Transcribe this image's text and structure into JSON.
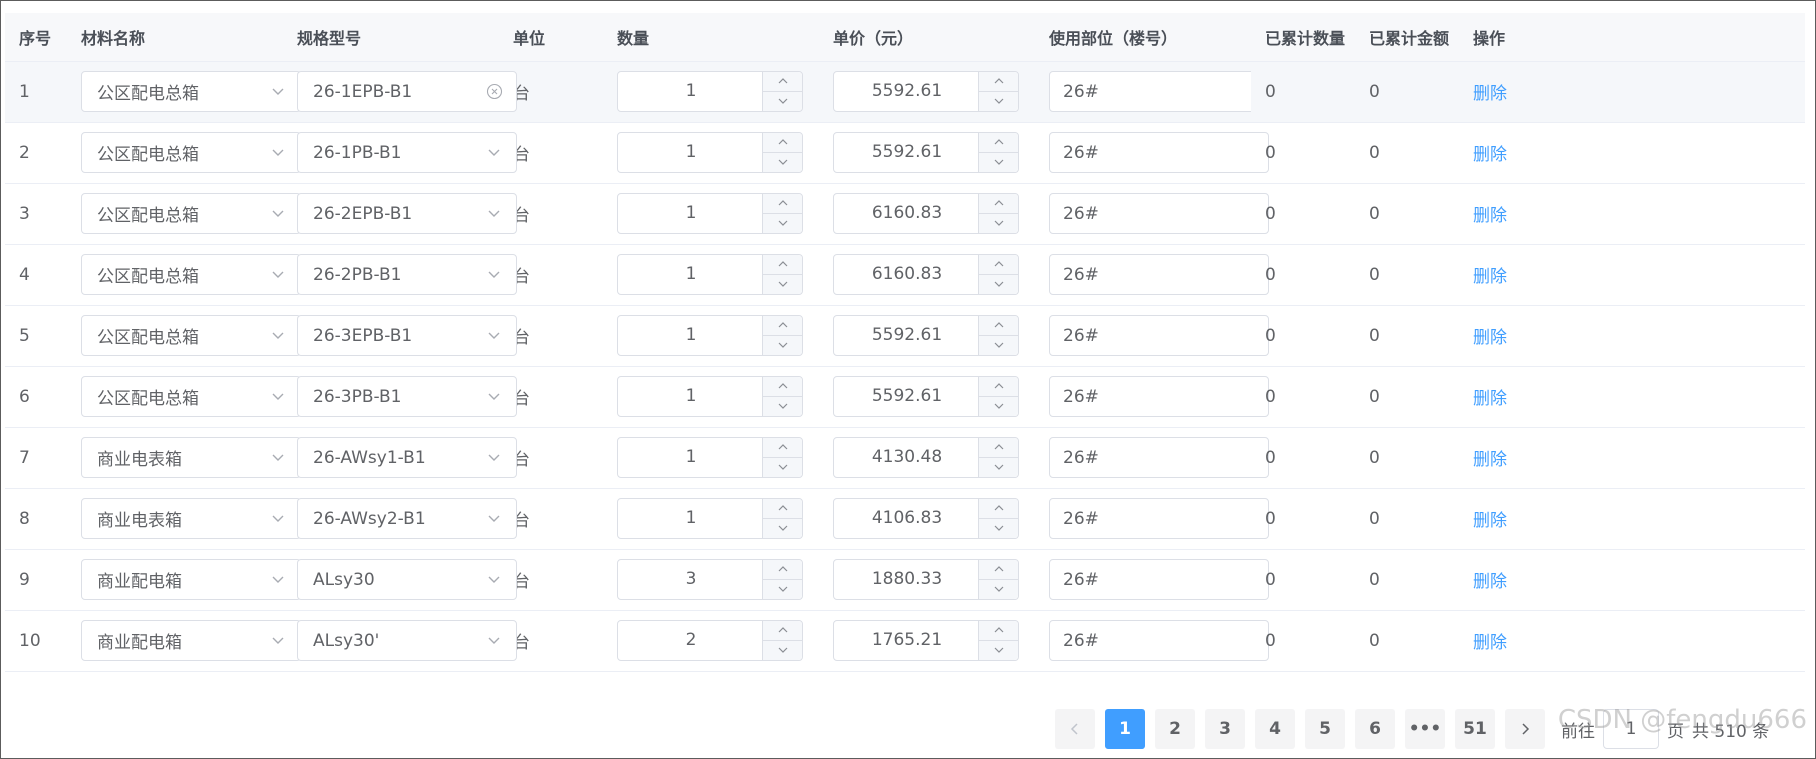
{
  "columns": [
    "序号",
    "材料名称",
    "规格型号",
    "单位",
    "数量",
    "单价（元）",
    "使用部位（楼号）",
    "已累计数量",
    "已累计金额",
    "操作"
  ],
  "rows": [
    {
      "index": "1",
      "material": "公区配电总箱",
      "spec": "26-1EPB-B1",
      "unit": "台",
      "qty": "1",
      "price": "5592.61",
      "location": "26#",
      "acc_qty": "0",
      "acc_amount": "0",
      "action": "删除"
    },
    {
      "index": "2",
      "material": "公区配电总箱",
      "spec": "26-1PB-B1",
      "unit": "台",
      "qty": "1",
      "price": "5592.61",
      "location": "26#",
      "acc_qty": "0",
      "acc_amount": "0",
      "action": "删除"
    },
    {
      "index": "3",
      "material": "公区配电总箱",
      "spec": "26-2EPB-B1",
      "unit": "台",
      "qty": "1",
      "price": "6160.83",
      "location": "26#",
      "acc_qty": "0",
      "acc_amount": "0",
      "action": "删除"
    },
    {
      "index": "4",
      "material": "公区配电总箱",
      "spec": "26-2PB-B1",
      "unit": "台",
      "qty": "1",
      "price": "6160.83",
      "location": "26#",
      "acc_qty": "0",
      "acc_amount": "0",
      "action": "删除"
    },
    {
      "index": "5",
      "material": "公区配电总箱",
      "spec": "26-3EPB-B1",
      "unit": "台",
      "qty": "1",
      "price": "5592.61",
      "location": "26#",
      "acc_qty": "0",
      "acc_amount": "0",
      "action": "删除"
    },
    {
      "index": "6",
      "material": "公区配电总箱",
      "spec": "26-3PB-B1",
      "unit": "台",
      "qty": "1",
      "price": "5592.61",
      "location": "26#",
      "acc_qty": "0",
      "acc_amount": "0",
      "action": "删除"
    },
    {
      "index": "7",
      "material": "商业电表箱",
      "spec": "26-AWsy1-B1",
      "unit": "台",
      "qty": "1",
      "price": "4130.48",
      "location": "26#",
      "acc_qty": "0",
      "acc_amount": "0",
      "action": "删除"
    },
    {
      "index": "8",
      "material": "商业电表箱",
      "spec": "26-AWsy2-B1",
      "unit": "台",
      "qty": "1",
      "price": "4106.83",
      "location": "26#",
      "acc_qty": "0",
      "acc_amount": "0",
      "action": "删除"
    },
    {
      "index": "9",
      "material": "商业配电箱",
      "spec": "ALsy30",
      "unit": "台",
      "qty": "3",
      "price": "1880.33",
      "location": "26#",
      "acc_qty": "0",
      "acc_amount": "0",
      "action": "删除"
    },
    {
      "index": "10",
      "material": "商业配电箱",
      "spec": "ALsy30'",
      "unit": "台",
      "qty": "2",
      "price": "1765.21",
      "location": "26#",
      "acc_qty": "0",
      "acc_amount": "0",
      "action": "删除"
    }
  ],
  "pagination": {
    "pages": [
      "1",
      "2",
      "3",
      "4",
      "5",
      "6"
    ],
    "more": "•••",
    "last": "51",
    "current": "1",
    "goto_prefix": "前往",
    "goto_value": "1",
    "goto_suffix": "页",
    "total": "共 510 条"
  },
  "watermark": "CSDN @fengdu666",
  "colors": {
    "accent": "#409eff",
    "header_bg": "#f7f8fa",
    "border": "#dcdfe6",
    "text": "#606266"
  }
}
